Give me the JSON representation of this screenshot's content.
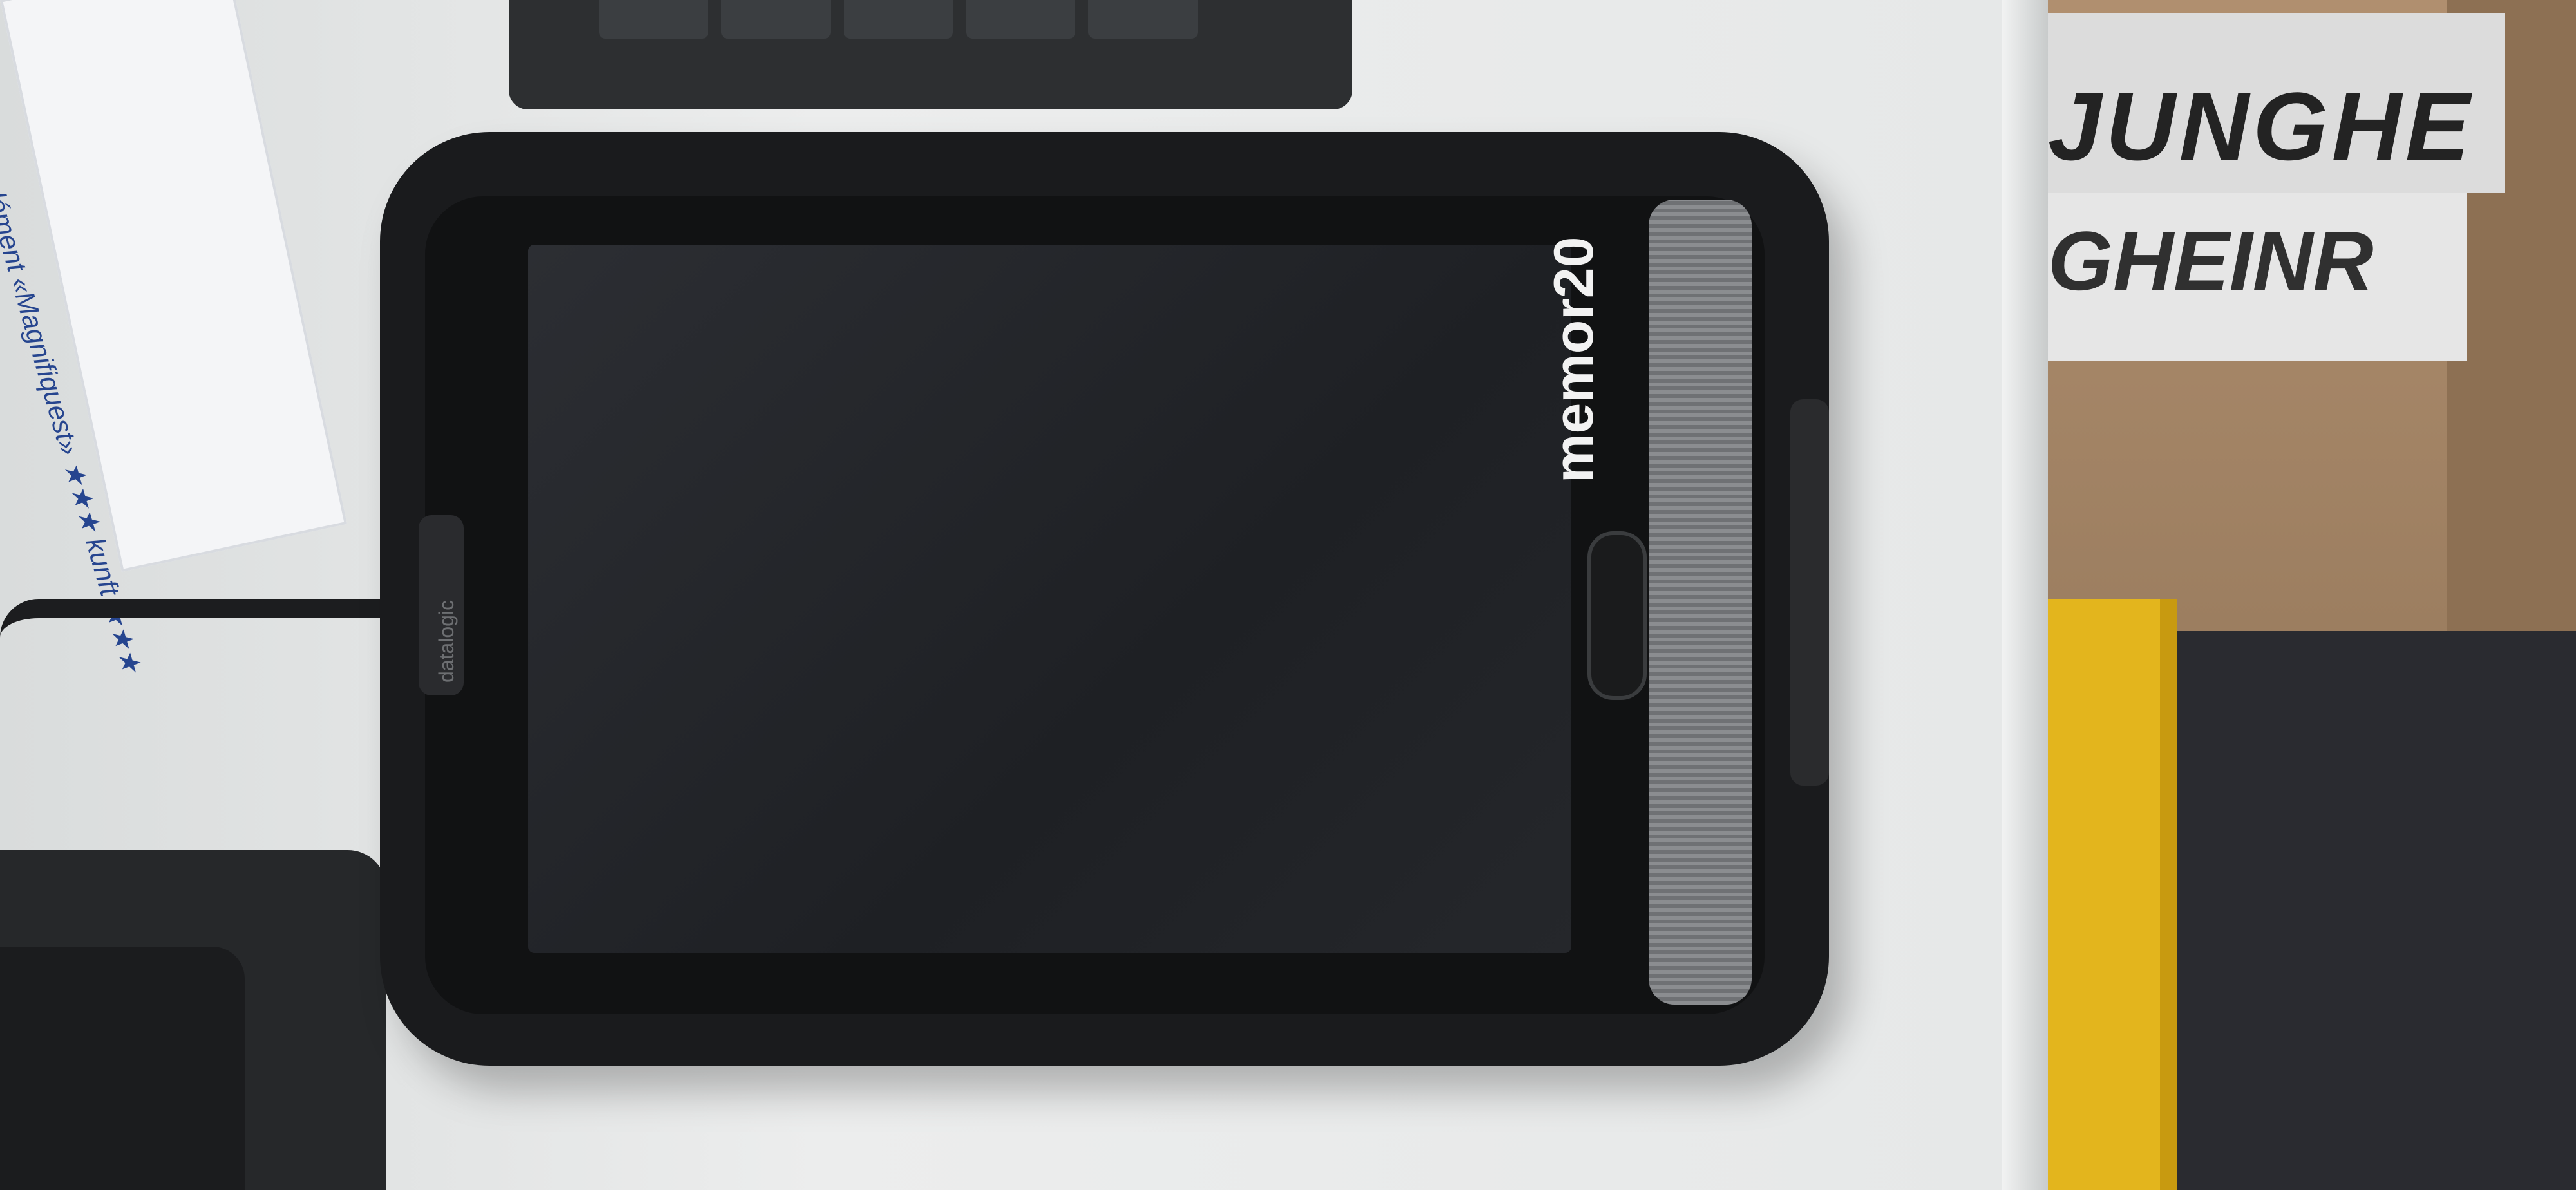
{
  "scene": {
    "device_brand_logo": "memor20",
    "device_side_brand": "datalogic",
    "background_sticker_line1": "JUNGHE",
    "background_sticker_line2": "GHEINR",
    "card_text": "plément «Magnifiquest» ★★★ kunft ★★★"
  },
  "colors": {
    "desk": "#e8eaea",
    "device_body": "#1a1b1d",
    "screen": "#24262a",
    "crate": "#e3b51d",
    "cardboard": "#a88a6b",
    "sticker_text": "#26458f"
  }
}
